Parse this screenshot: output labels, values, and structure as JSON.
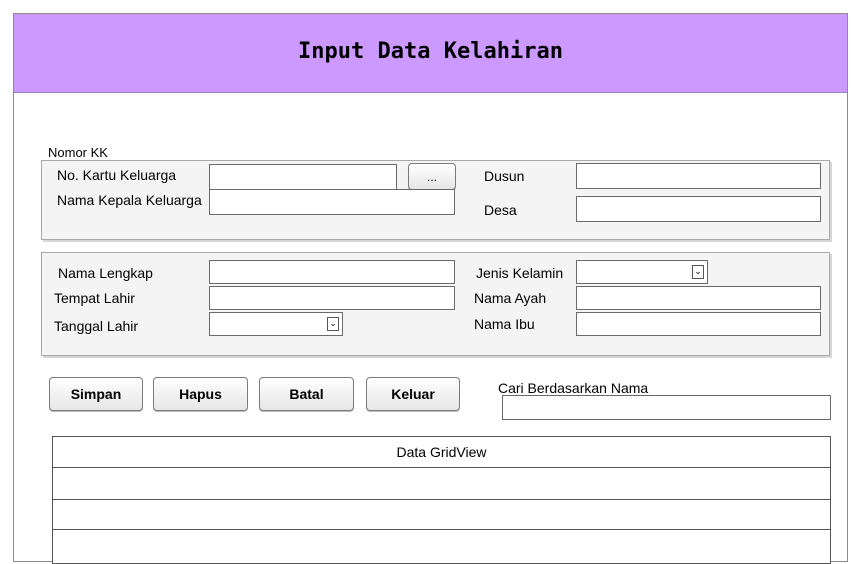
{
  "window": {
    "title": "Input Data Kelahiran"
  },
  "nomor_kk": {
    "legend": "Nomor KK",
    "no_kartu_label": "No. Kartu Keluarga",
    "browse_label": "...",
    "nama_kepala_label": "Nama Kepala Keluarga",
    "dusun_label": "Dusun",
    "desa_label": "Desa"
  },
  "person": {
    "nama_lengkap_label": "Nama Lengkap",
    "tempat_lahir_label": "Tempat Lahir",
    "tanggal_lahir_label": "Tanggal Lahir",
    "jenis_kelamin_label": "Jenis Kelamin",
    "nama_ayah_label": "Nama Ayah",
    "nama_ibu_label": "Nama Ibu"
  },
  "actions": {
    "simpan": "Simpan",
    "hapus": "Hapus",
    "batal": "Batal",
    "keluar": "Keluar"
  },
  "search": {
    "label": "Cari Berdasarkan Nama"
  },
  "grid": {
    "header": "Data GridView"
  },
  "icons": {
    "dropdown": "chevron-down-icon"
  }
}
